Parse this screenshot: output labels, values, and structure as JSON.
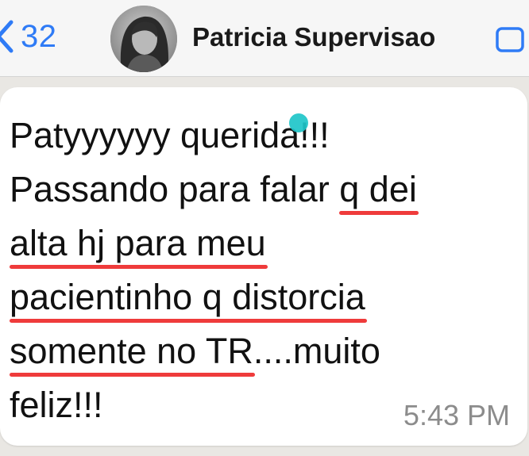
{
  "header": {
    "back_count": "32",
    "contact_name": "Patricia Supervisao"
  },
  "message": {
    "line1": "Patyyyyyy querida!!!",
    "line2_a": "Passando para falar ",
    "line2_b": "q dei",
    "line3": "alta hj para meu",
    "line4": "pacientinho q distorcia",
    "line5_a": "somente no TR",
    "line5_b": "....muito",
    "line6": "feliz!!!",
    "time": "5:43 PM"
  },
  "colors": {
    "accent": "#2f7bf6",
    "underline": "#ef3b3b",
    "dot": "#1ec6c9"
  },
  "icons": [
    "back-chevron-icon",
    "video-call-icon"
  ]
}
